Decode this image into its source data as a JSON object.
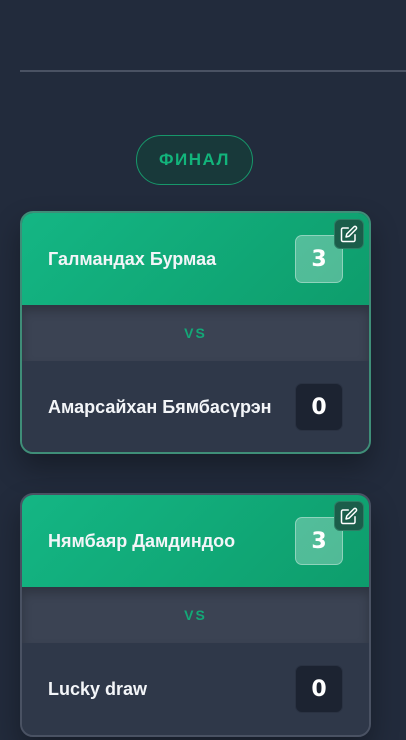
{
  "stage": {
    "label": "ФИНАЛ"
  },
  "matches": [
    {
      "team_a": {
        "name": "Галмандах Бурмаа",
        "score": "3"
      },
      "vs_label": "VS",
      "team_b": {
        "name": "Амарсайхан Бямбасүрэн",
        "score": "0"
      },
      "edit_icon": "edit-icon"
    },
    {
      "team_a": {
        "name": "Нямбаяр Дамдиндоо",
        "score": "3"
      },
      "vs_label": "VS",
      "team_b": {
        "name": "Lucky draw",
        "score": "0"
      },
      "edit_icon": "edit-icon"
    }
  ],
  "colors": {
    "background": "#222b3c",
    "accent": "#12b47b",
    "winner_row": "#14b684",
    "card": "#2f3849"
  }
}
